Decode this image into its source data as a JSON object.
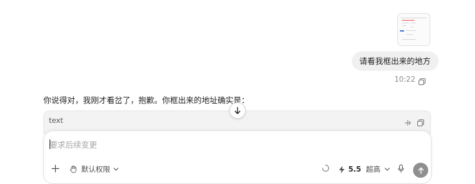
{
  "conversation": {
    "user_message": {
      "text": "请看我框出来的地方",
      "time": "10:22"
    },
    "assistant_message": {
      "text": "你说得对，我刚才看岔了，抱歉。你框出来的地址确实是："
    },
    "code_block": {
      "language": "text"
    }
  },
  "composer": {
    "placeholder": "要求后续变更",
    "permissions_label": "默认权限",
    "model_version": "5.5",
    "model_mode": "超高"
  },
  "colors": {
    "send_button": "#8f8f8f",
    "bubble_bg": "#f0f0f0",
    "code_header_bg": "#f3f3f3"
  },
  "icons": [
    "image-attachment-thumbnail",
    "copy-icon",
    "scroll-down-arrow-icon",
    "wrap-icon",
    "plus-icon",
    "hand-icon",
    "chevron-down-icon",
    "loading-spinner-icon",
    "lightning-icon",
    "microphone-icon",
    "arrow-up-icon"
  ]
}
